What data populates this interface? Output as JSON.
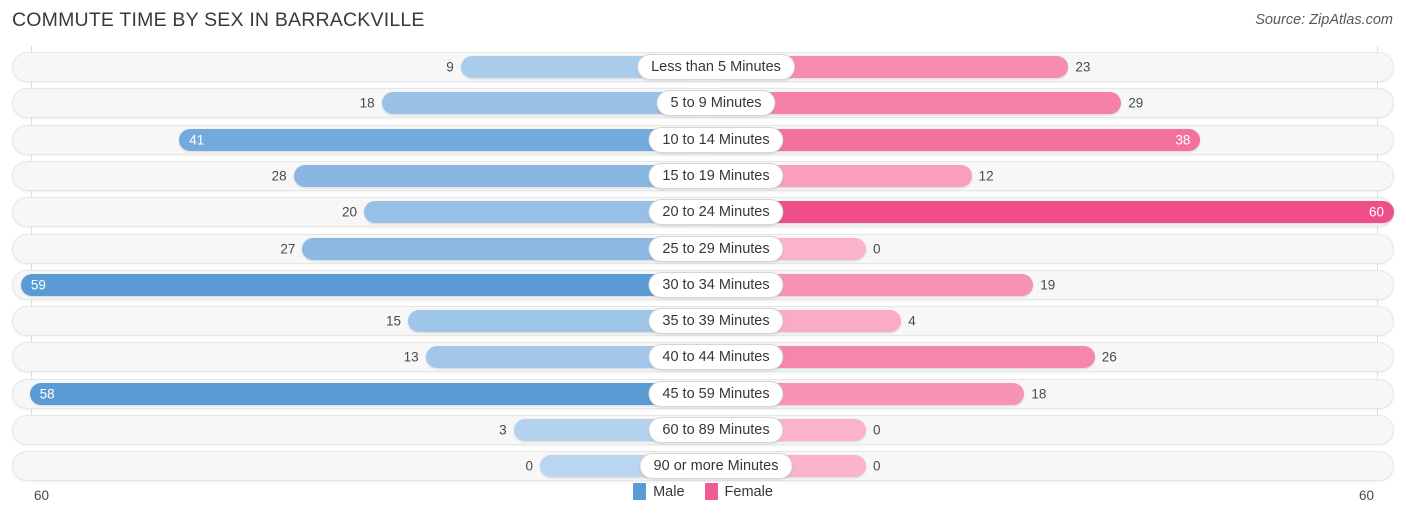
{
  "header": {
    "title": "COMMUTE TIME BY SEX IN BARRACKVILLE",
    "source": "Source: ZipAtlas.com"
  },
  "legend": {
    "male_label": "Male",
    "female_label": "Female",
    "male_color": "#5b9bd5",
    "female_color": "#ef5b92"
  },
  "axis": {
    "left_label": "60",
    "right_label": "60",
    "max": 60
  },
  "chart_data": {
    "type": "bar",
    "title": "COMMUTE TIME BY SEX IN BARRACKVILLE",
    "subtitle": "Source: ZipAtlas.com",
    "orientation": "horizontal-diverging",
    "xlabel": "",
    "ylabel": "",
    "xlim": [
      60,
      60
    ],
    "grid": true,
    "legend_position": "bottom-center",
    "categories": [
      "Less than 5 Minutes",
      "5 to 9 Minutes",
      "10 to 14 Minutes",
      "15 to 19 Minutes",
      "20 to 24 Minutes",
      "25 to 29 Minutes",
      "30 to 34 Minutes",
      "35 to 39 Minutes",
      "40 to 44 Minutes",
      "45 to 59 Minutes",
      "60 to 89 Minutes",
      "90 or more Minutes"
    ],
    "series": [
      {
        "name": "Male",
        "color": "#5b9bd5",
        "values": [
          9,
          18,
          41,
          28,
          20,
          27,
          59,
          15,
          13,
          58,
          3,
          0
        ]
      },
      {
        "name": "Female",
        "color": "#ef5b92",
        "values": [
          23,
          29,
          38,
          12,
          60,
          0,
          19,
          4,
          26,
          18,
          0,
          0
        ]
      }
    ]
  },
  "rows": [
    {
      "label": "Less than 5 Minutes",
      "male": "9",
      "female": "23"
    },
    {
      "label": "5 to 9 Minutes",
      "male": "18",
      "female": "29"
    },
    {
      "label": "10 to 14 Minutes",
      "male": "41",
      "female": "38"
    },
    {
      "label": "15 to 19 Minutes",
      "male": "28",
      "female": "12"
    },
    {
      "label": "20 to 24 Minutes",
      "male": "20",
      "female": "60"
    },
    {
      "label": "25 to 29 Minutes",
      "male": "27",
      "female": "0"
    },
    {
      "label": "30 to 34 Minutes",
      "male": "59",
      "female": "19"
    },
    {
      "label": "35 to 39 Minutes",
      "male": "15",
      "female": "4"
    },
    {
      "label": "40 to 44 Minutes",
      "male": "13",
      "female": "26"
    },
    {
      "label": "45 to 59 Minutes",
      "male": "58",
      "female": "18"
    },
    {
      "label": "60 to 89 Minutes",
      "male": "3",
      "female": "0"
    },
    {
      "label": "90 or more Minutes",
      "male": "0",
      "female": "0"
    }
  ]
}
